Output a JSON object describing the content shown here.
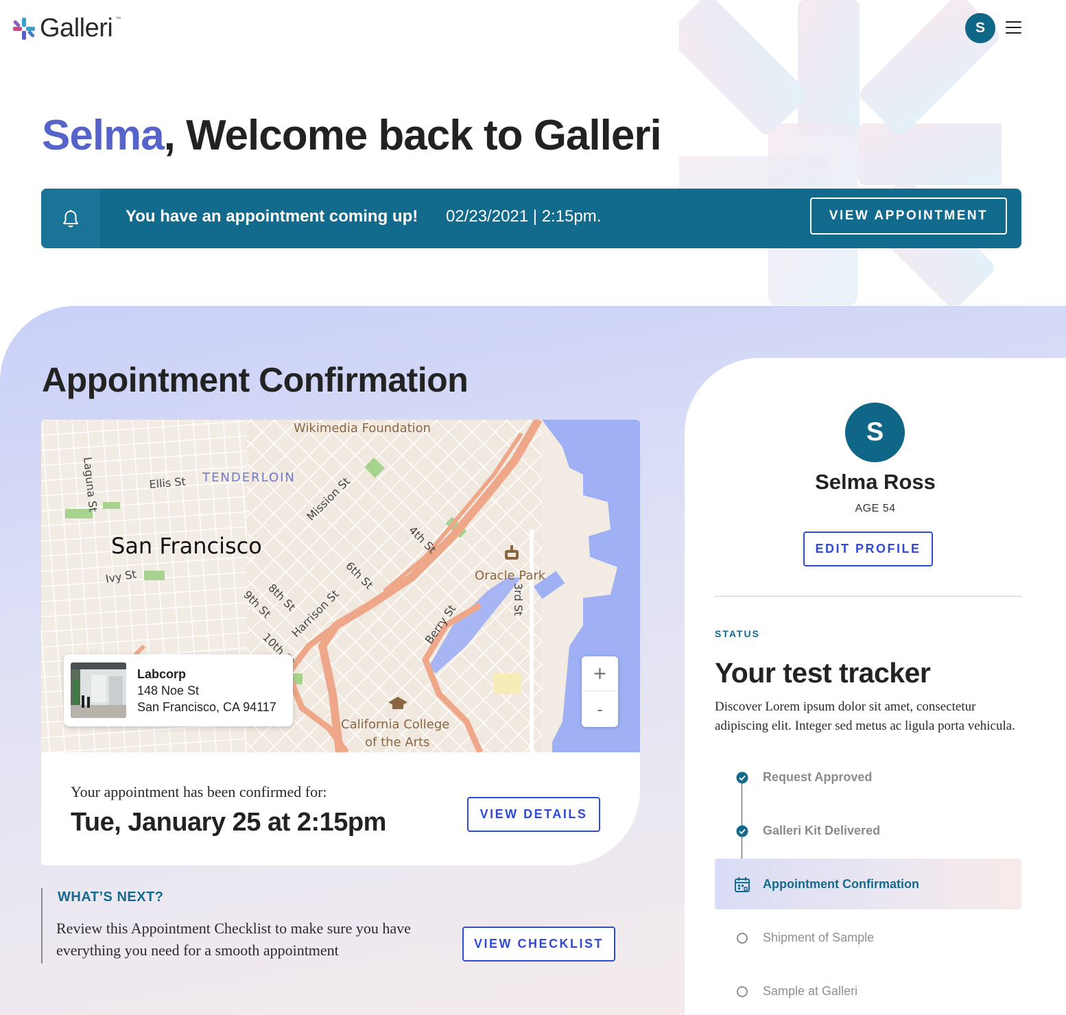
{
  "brand": {
    "name": "Galleri",
    "tm": "™"
  },
  "header": {
    "avatar_initial": "S"
  },
  "welcome": {
    "name": "Selma",
    "rest": ", Welcome back to Galleri"
  },
  "banner": {
    "message": "You have an appointment coming up!",
    "datetime": "02/23/2021 | 2:15pm.",
    "button": "VIEW APPOINTMENT"
  },
  "appointment": {
    "title": "Appointment Confirmation",
    "map": {
      "labels": {
        "wikimedia": "Wikimedia Foundation",
        "tenderloin": "TENDERLOIN",
        "ellis": "Ellis St",
        "laguna": "Laguna St",
        "mission": "Mission St",
        "city": "San Francisco",
        "fourth": "4th St",
        "sixth": "6th St",
        "eighth": "8th St",
        "ninth": "9th St",
        "tenth": "10th St",
        "harrison": "Harrison St",
        "ivy": "Ivy St",
        "berry": "Berry St",
        "oracle": "Oracle Park",
        "third": "3rd St",
        "college1": "California College",
        "college2": "of the Arts"
      },
      "location": {
        "name": "Labcorp",
        "address1": "148 Noe St",
        "address2": "San Francisco, CA 94117"
      },
      "zoom_in": "+",
      "zoom_out": "-"
    },
    "confirmed_label": "Your appointment has been confirmed for:",
    "confirmed_date": "Tue, January 25 at 2:15pm",
    "details_button": "VIEW DETAILS"
  },
  "whats_next": {
    "title": "WHAT’S NEXT?",
    "text": "Review this Appointment Checklist to make sure you have everything you need for a smooth appointment",
    "button": "VIEW CHECKLIST"
  },
  "profile": {
    "initial": "S",
    "name": "Selma Ross",
    "age": "AGE 54",
    "edit_button": "EDIT PROFILE"
  },
  "tracker": {
    "status_label": "STATUS",
    "title": "Your test tracker",
    "description": "Discover Lorem ipsum dolor sit amet, consectetur adipiscing elit. Integer sed metus ac ligula porta vehicula.",
    "steps": [
      {
        "label": "Request Approved",
        "state": "done"
      },
      {
        "label": "Galleri Kit Delivered",
        "state": "done"
      },
      {
        "label": "Appointment Confirmation",
        "state": "active"
      },
      {
        "label": "Shipment of Sample",
        "state": "todo"
      },
      {
        "label": "Sample at Galleri",
        "state": "todo"
      }
    ]
  },
  "colors": {
    "brand_teal": "#126a8c",
    "accent_blue": "#2f4bd6",
    "name_purple": "#5663c8"
  }
}
